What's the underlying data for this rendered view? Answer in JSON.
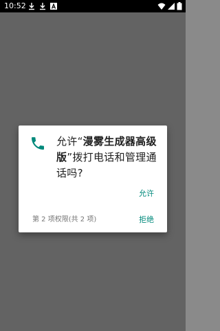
{
  "status_bar": {
    "time": "10:52",
    "icons": [
      "download-icon",
      "download-icon",
      "a-badge-icon",
      "wifi-icon",
      "cellular-signal-icon",
      "battery-icon"
    ]
  },
  "dialog": {
    "icon": "phone-icon",
    "message_prefix": "允许“",
    "app_name": "漫雾生成器高级版",
    "message_suffix": "”拨打电话和管理通话吗?",
    "allow_label": "允许",
    "deny_label": "拒绝",
    "counter_text": "第 2 项权限(共 2 项)"
  },
  "colors": {
    "accent": "#00897b",
    "scrim": "#636363",
    "status_bar": "#000000"
  }
}
